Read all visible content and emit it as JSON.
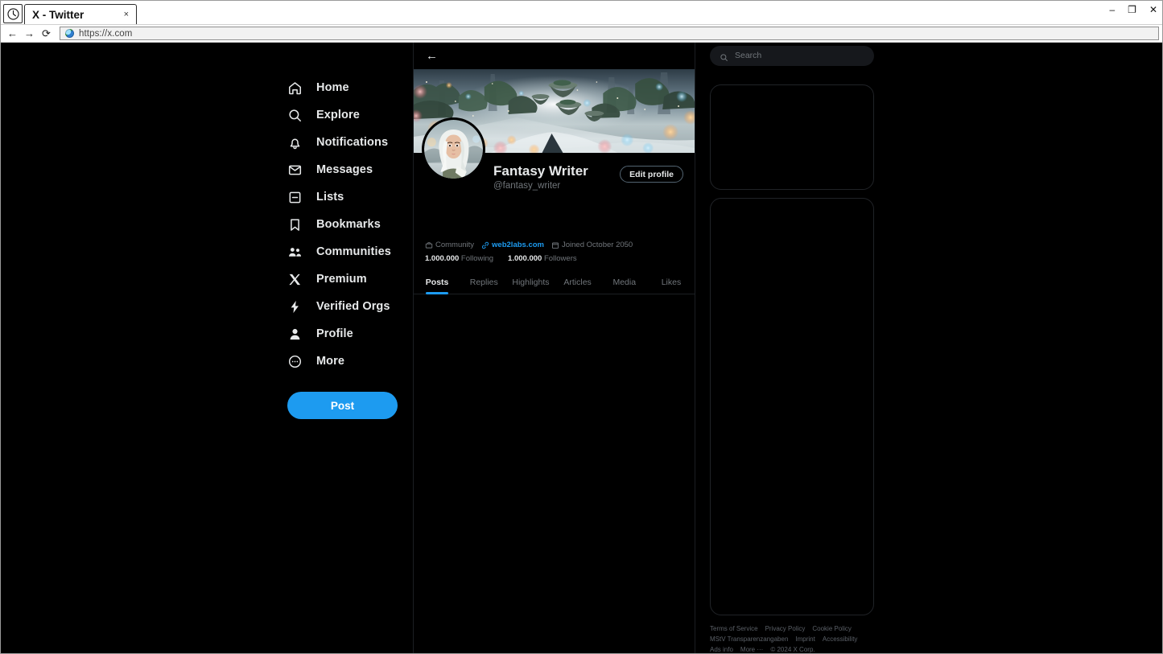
{
  "window": {
    "app_icon": "clock-icon",
    "tab_title": "X - Twitter",
    "tab_close": "×",
    "minimize": "–",
    "maximize": "❐",
    "close": "✕"
  },
  "browser": {
    "back": "←",
    "forward": "→",
    "reload": "⟳",
    "favicon": "globe-icon",
    "url": "https://x.com"
  },
  "sidebar": {
    "items": [
      {
        "label": "Home",
        "icon": "home-icon"
      },
      {
        "label": "Explore",
        "icon": "search-icon"
      },
      {
        "label": "Notifications",
        "icon": "bell-icon"
      },
      {
        "label": "Messages",
        "icon": "envelope-icon"
      },
      {
        "label": "Lists",
        "icon": "list-icon"
      },
      {
        "label": "Bookmarks",
        "icon": "bookmark-icon"
      },
      {
        "label": "Communities",
        "icon": "people-icon"
      },
      {
        "label": "Premium",
        "icon": "x-logo-icon"
      },
      {
        "label": "Verified Orgs",
        "icon": "lightning-icon"
      },
      {
        "label": "Profile",
        "icon": "person-icon"
      },
      {
        "label": "More",
        "icon": "more-circle-icon"
      }
    ],
    "post_button": "Post"
  },
  "profile": {
    "back": "←",
    "display_name": "Fantasy Writer",
    "handle": "@fantasy_writer",
    "edit_button": "Edit profile",
    "meta": {
      "community_label": "Community",
      "community_icon": "briefcase-icon",
      "link_label": "web2labs.com",
      "link_icon": "link-icon",
      "joined_label": "Joined October 2050",
      "joined_icon": "calendar-icon"
    },
    "stats": {
      "following_count": "1.000.000",
      "following_label": "Following",
      "followers_count": "1.000.000",
      "followers_label": "Followers"
    },
    "tabs": [
      {
        "label": "Posts",
        "active": true
      },
      {
        "label": "Replies",
        "active": false
      },
      {
        "label": "Highlights",
        "active": false
      },
      {
        "label": "Articles",
        "active": false
      },
      {
        "label": "Media",
        "active": false
      },
      {
        "label": "Likes",
        "active": false
      }
    ]
  },
  "search": {
    "placeholder": "Search",
    "value": "",
    "icon": "search-icon"
  },
  "footer": {
    "links": [
      "Terms of Service",
      "Privacy Policy",
      "Cookie Policy",
      "MStV Transparenzangaben",
      "Imprint",
      "Accessibility",
      "Ads info",
      "More ···"
    ],
    "copyright": "© 2024 X Corp."
  },
  "colors": {
    "accent": "#1d9bf0",
    "page_bg": "#000000",
    "text": "#e7e9ea",
    "muted": "#71767b",
    "border": "#1b1f23",
    "search_bg": "#16181c"
  }
}
